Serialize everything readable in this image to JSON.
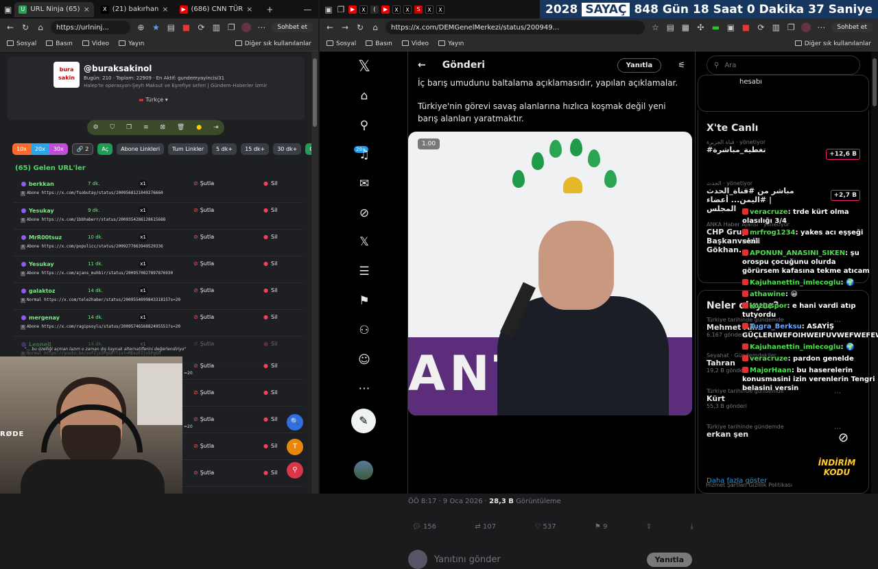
{
  "left_browser": {
    "tabs": [
      {
        "label": "URL Ninja (65)",
        "active": true
      },
      {
        "label": "(21) bakırhan",
        "active": false
      },
      {
        "label": "(686) CNN TÜR",
        "active": false
      }
    ],
    "url": "https://urlninj...",
    "chat_button": "Sohbet et",
    "bookmarks": [
      "Sosyal",
      "Basın",
      "Video",
      "Yayın"
    ],
    "bookmarks_other": "Diğer sık kullanılanlar"
  },
  "urlninja": {
    "avatar_text": "bura\nsakin",
    "handle": "@buraksakinol",
    "stats_prefix": "Bugün: 210 · Toplam: 22909 · En Aktif: gundemyayincisi31",
    "description": "Halep'te operasyon-Şeyh Maksut ve Eşrefiye seferi | Gündem-Haberler İzmir",
    "language": "Türkçe",
    "filter_buttons": [
      "10x",
      "20x",
      "30x",
      "🔗 2",
      "Aç",
      "Abone Linkleri",
      "Tum Linkler",
      "5 dk+",
      "15 dk+",
      "30 dk+",
      "Güvenli"
    ],
    "section_title": "(65) Gelen URL'ler",
    "rows": [
      {
        "user": "berkkan",
        "time": "7 dk.",
        "count": "x1",
        "url": "Abone https://x.com/fsobutay/status/2009568121049276660"
      },
      {
        "user": "Yesukay",
        "time": "9 dk.",
        "count": "x1",
        "url": "Abone https://x.com/1bbhaberr/status/2009354286128615688"
      },
      {
        "user": "MrR00tsuz",
        "time": "10 dk.",
        "count": "x1",
        "url": "Abone https://x.com/populicc/status/2009277663949529336"
      },
      {
        "user": "Yesukay",
        "time": "11 dk.",
        "count": "x1",
        "url": "Abone https://x.com/ajans_muhbir/status/2009570827897876930"
      },
      {
        "user": "galaktoz",
        "time": "14 dk.",
        "count": "x1",
        "url": "Normal https://x.com/tele2haber/status/2009554099843318157s=20"
      },
      {
        "user": "mergenay",
        "time": "14 dk.",
        "count": "x1",
        "url": "Abone https://x.com/ragipsoylu/status/2009574656882495551?s=20"
      },
      {
        "user": "Leonell",
        "time": "14 dk.",
        "count": "x1",
        "url": "Normal https://youtu.be/xvFZjo5PgG0?list=RDxvFZjo5PgG0"
      }
    ],
    "note": "\"... bu özelliği açman lazım o zaman dış kaynak alternatiflerini değerlendiriyo\"",
    "lower_rows": [
      "Şutla",
      "Şutla",
      "Şutla",
      "Şutla",
      "Şutla"
    ],
    "sutla": "Şutla",
    "sil": "Sil",
    "lower_suffixes": [
      "=20",
      "",
      "=20",
      "",
      ""
    ]
  },
  "webcam": {
    "mic_brand": "RØDE"
  },
  "right_browser": {
    "url": "https://x.com/DEMGenelMerkezi/status/200949...",
    "chat_button": "Sohbet et",
    "bookmarks": [
      "Sosyal",
      "Basın",
      "Video",
      "Yayın"
    ],
    "bookmarks_other": "Diğer sık kullanılanlar"
  },
  "countdown": {
    "year": "2028",
    "label": "SAYAÇ",
    "days": "848 Gün",
    "hours": "18 Saat",
    "minutes": "0 Dakika",
    "seconds": "37 Saniye"
  },
  "x_nav": {
    "badge": "20+"
  },
  "post": {
    "header_title": "Gönderi",
    "reply_header_btn": "Yanıtla",
    "text1": "İç barış umudunu baltalama açıklamasıdır, yapılan açıklamalar.",
    "text2": "Türkiye'nin görevi savaş alanlarına hızlıca koşmak değil yeni barış alanları yaratmaktır.",
    "media_tag": "1.00",
    "media_banner": "ANTI",
    "time": "ÖÖ 8:17 · 9 Oca 2026 · ",
    "views": "28,3 B",
    "views_label": " Görüntüleme",
    "stats": {
      "replies": "156",
      "reposts": "107",
      "likes": "537",
      "bookmarks": "9"
    },
    "reply_placeholder": "Yanıtını gönder",
    "reply_button": "Yanıtla"
  },
  "sidebar": {
    "search_placeholder": "Ara",
    "hesabi": "hesabı",
    "live_title": "X'te Canlı",
    "live": [
      {
        "source": "قناة الجزيرة · yönetiyor",
        "title": "#تغطية_مباشرة",
        "count": "+12,6 B"
      },
      {
        "source": "الحدث · yönetiyor",
        "title": "مباشر من #قناة_الحدث | #اليمن... أعضاء المجلس",
        "count": "+2,7 B"
      },
      {
        "source": "ANKA Haber Ajansı · yönetiyor",
        "title": "CHP Grup Başkanvekili Gökhan...",
        "count": ""
      }
    ],
    "trends_title": "Neler oluyor?",
    "trends": [
      {
        "cat": "Türkiye tarihinde gündemde",
        "name": "Mehmet Ali...",
        "count": "6.167 gönderi"
      },
      {
        "cat": "Seyahat · Gündemdekiler",
        "name": "Tahran",
        "count": "19,2 B gönderi"
      },
      {
        "cat": "Türkiye tarihinde gündemde",
        "name": "Kürt",
        "count": "55,3 B gönderi"
      },
      {
        "cat": "Türkiye tarihinde gündemde",
        "name": "erkan şen",
        "count": ""
      }
    ],
    "show_more": "Daha fazla göster",
    "footer": "Hizmet Şartları   Gizlilik Politikası"
  },
  "chat": [
    {
      "user": "veracruze",
      "msg": "trde kürt olma olasılığı 3/4"
    },
    {
      "user": "mrfrog1234",
      "msg": "yakes acı eşşeği seni"
    },
    {
      "user": "APONUN_ANASINI_SIKEN",
      "msg": "şu orospu çocuğunu olurda görürsem kafasına tekme atıcam"
    },
    {
      "user": "Kajuhanettin_imlecoglu",
      "msg": "🌍"
    },
    {
      "user": "athawine",
      "msg": "😀"
    },
    {
      "user": "kozluspor",
      "msg": "e hani vardi atıp tutyordu"
    },
    {
      "user": "Tugra_Berksu",
      "msg": "ASAYİŞ GÜÇLERIWEFOIHWEIFUVWEFWEFEWF"
    },
    {
      "user": "Kajuhanettin_imlecoglu",
      "msg": "🌍"
    },
    {
      "user": "veracruze",
      "msg": "pardon genelde"
    },
    {
      "user": "MajorHaan",
      "msg": "bu haserelerin konusmasini izin verenlerin Tengri belasini versin"
    }
  ],
  "promo": "İNDİRİM KODU",
  "colors": {
    "x_blue": "#1d9bf0",
    "green_user": "#7ee787",
    "counter_bg": "#17375e",
    "dem_purple": "#5b2d7a"
  }
}
